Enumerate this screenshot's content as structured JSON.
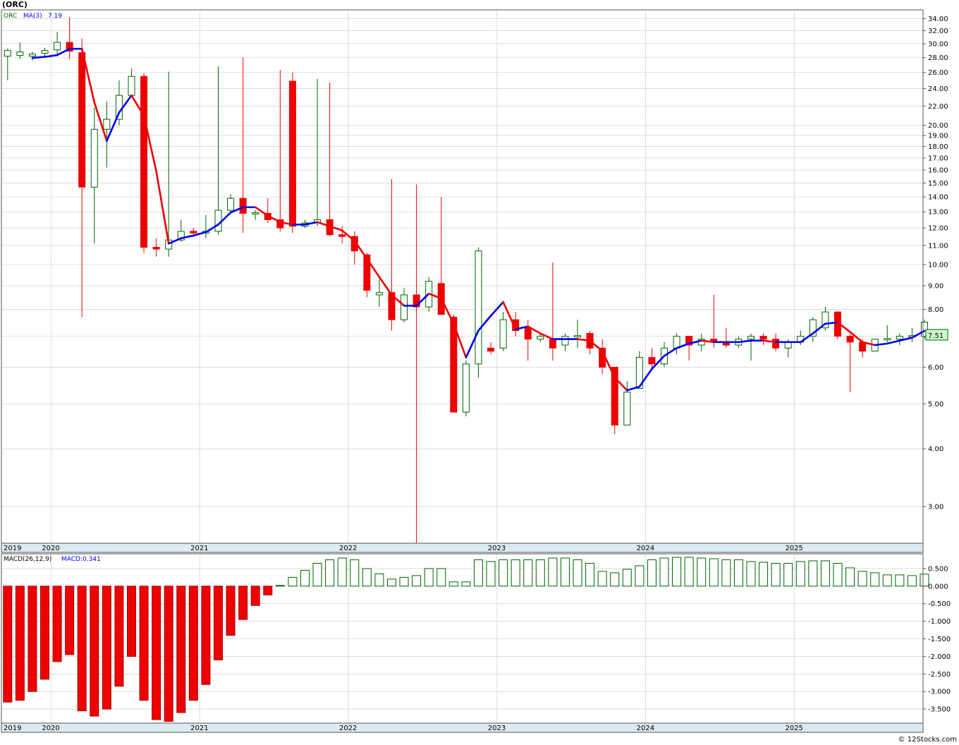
{
  "symbol": "(ORC)",
  "price_legend": {
    "ticker": "ORC",
    "ma_label": "MA(3)",
    "ma_value": "7.19"
  },
  "macd_legend": {
    "label": "MACD(26,12,9)",
    "value_label": "MACD:0.341"
  },
  "last_price": "7.51",
  "watermark": "© 12Stocks.com",
  "colors": {
    "up": "#006400",
    "down": "#ee0000",
    "ma_up": "#0000ee",
    "ma_down": "#ee0000",
    "axis_band": "#dceaf2",
    "grid": "#c8c8c8",
    "last_price_bg": "#ccffcc"
  },
  "chart_data": [
    {
      "type": "candlestick",
      "interval": "monthly",
      "scale": "log",
      "ylim": [
        2.5,
        35.5
      ],
      "y_ticks": [
        "3.00",
        "4.00",
        "5.00",
        "6.00",
        "7.00",
        "8.00",
        "9.00",
        "10.00",
        "11.00",
        "12.00",
        "13.00",
        "14.00",
        "15.00",
        "16.00",
        "17.00",
        "18.00",
        "19.00",
        "20.00",
        "22.00",
        "24.00",
        "26.00",
        "28.00",
        "30.00",
        "32.00",
        "34.00"
      ],
      "x_labels": [
        "2019",
        "2020",
        "2021",
        "2022",
        "2023",
        "2024",
        "2025"
      ],
      "x_label_months": [
        0,
        4,
        16,
        28,
        40,
        52,
        64
      ],
      "grid": true,
      "ohlc": [
        [
          28.2,
          29.3,
          25.0,
          29.0
        ],
        [
          28.3,
          30.2,
          27.8,
          28.8
        ],
        [
          28.2,
          28.8,
          27.6,
          28.5
        ],
        [
          28.6,
          29.4,
          28.0,
          29.0
        ],
        [
          29.1,
          31.8,
          28.5,
          30.2
        ],
        [
          30.2,
          34.2,
          27.8,
          28.9
        ],
        [
          28.7,
          30.8,
          7.7,
          14.7
        ],
        [
          14.7,
          21.8,
          11.1,
          19.6
        ],
        [
          19.6,
          22.5,
          16.2,
          20.6
        ],
        [
          20.6,
          25.0,
          20.0,
          23.2
        ],
        [
          23.2,
          26.5,
          23.0,
          25.5
        ],
        [
          25.5,
          25.9,
          10.6,
          10.9
        ],
        [
          10.9,
          11.4,
          10.4,
          10.8
        ],
        [
          10.8,
          26.1,
          10.4,
          11.3
        ],
        [
          11.3,
          12.5,
          11.2,
          11.8
        ],
        [
          11.8,
          12.0,
          11.5,
          11.7
        ],
        [
          11.7,
          12.8,
          11.4,
          11.8
        ],
        [
          11.8,
          26.8,
          11.6,
          13.1
        ],
        [
          13.1,
          14.2,
          13.0,
          13.9
        ],
        [
          13.9,
          28.0,
          11.7,
          12.9
        ],
        [
          12.9,
          13.1,
          12.5,
          12.9
        ],
        [
          12.9,
          13.9,
          12.3,
          12.5
        ],
        [
          12.5,
          26.3,
          11.8,
          12.0
        ],
        [
          24.9,
          26.0,
          11.7,
          12.1
        ],
        [
          12.1,
          12.5,
          12.0,
          12.3
        ],
        [
          12.3,
          25.2,
          12.1,
          12.5
        ],
        [
          12.5,
          24.7,
          11.5,
          11.6
        ],
        [
          11.6,
          12.1,
          11.1,
          11.5
        ],
        [
          11.5,
          11.8,
          10.0,
          10.7
        ],
        [
          10.5,
          10.6,
          8.5,
          8.8
        ],
        [
          8.6,
          9.3,
          8.1,
          8.7
        ],
        [
          8.7,
          15.3,
          7.2,
          7.6
        ],
        [
          7.6,
          8.9,
          7.5,
          8.6
        ],
        [
          8.6,
          14.9,
          2.5,
          8.1
        ],
        [
          8.1,
          9.4,
          7.9,
          9.2
        ],
        [
          9.1,
          14.0,
          7.8,
          7.8
        ],
        [
          7.7,
          7.8,
          4.8,
          4.8
        ],
        [
          4.8,
          6.2,
          4.7,
          6.1
        ],
        [
          6.1,
          10.9,
          5.7,
          10.7
        ],
        [
          6.6,
          6.8,
          6.4,
          6.5
        ],
        [
          6.6,
          7.9,
          6.5,
          7.6
        ],
        [
          7.6,
          7.9,
          7.0,
          7.2
        ],
        [
          7.3,
          7.6,
          6.2,
          6.9
        ],
        [
          6.9,
          7.1,
          6.8,
          7.0
        ],
        [
          6.9,
          10.1,
          6.2,
          6.6
        ],
        [
          6.7,
          7.1,
          6.5,
          7.0
        ],
        [
          7.0,
          7.6,
          6.6,
          7.0
        ],
        [
          7.1,
          7.2,
          6.4,
          6.6
        ],
        [
          6.6,
          6.9,
          5.8,
          6.0
        ],
        [
          6.0,
          6.0,
          4.3,
          4.5
        ],
        [
          4.5,
          5.6,
          4.5,
          5.3
        ],
        [
          5.4,
          6.5,
          5.4,
          6.3
        ],
        [
          6.3,
          6.6,
          5.9,
          6.1
        ],
        [
          6.1,
          6.8,
          6.0,
          6.6
        ],
        [
          6.6,
          7.1,
          6.4,
          7.0
        ],
        [
          7.0,
          7.0,
          6.2,
          6.7
        ],
        [
          6.7,
          7.1,
          6.5,
          6.9
        ],
        [
          6.9,
          8.6,
          6.6,
          6.8
        ],
        [
          6.8,
          7.3,
          6.6,
          6.7
        ],
        [
          6.7,
          7.0,
          6.6,
          6.9
        ],
        [
          6.9,
          7.1,
          6.2,
          7.0
        ],
        [
          7.0,
          7.1,
          6.7,
          6.9
        ],
        [
          6.9,
          7.1,
          6.5,
          6.6
        ],
        [
          6.6,
          6.9,
          6.3,
          6.8
        ],
        [
          6.8,
          7.2,
          6.7,
          7.0
        ],
        [
          7.0,
          7.7,
          6.8,
          7.6
        ],
        [
          7.3,
          8.1,
          7.2,
          7.9
        ],
        [
          7.9,
          7.9,
          6.9,
          7.0
        ],
        [
          7.0,
          7.1,
          5.3,
          6.8
        ],
        [
          6.8,
          6.9,
          6.3,
          6.5
        ],
        [
          6.5,
          6.9,
          6.5,
          6.9
        ],
        [
          6.9,
          7.4,
          6.8,
          6.9
        ],
        [
          6.9,
          7.1,
          6.7,
          7.0
        ],
        [
          7.0,
          7.3,
          6.8,
          7.0
        ],
        [
          7.0,
          7.6,
          6.9,
          7.51
        ]
      ],
      "ma3": [
        null,
        null,
        27.95,
        28.1,
        28.35,
        29.25,
        29.25,
        22.4,
        18.5,
        21.3,
        23.2,
        20.95,
        15.9,
        11.1,
        11.4,
        11.55,
        11.75,
        12.2,
        12.95,
        13.3,
        13.3,
        12.75,
        12.35,
        12.2,
        12.2,
        12.35,
        12.1,
        11.85,
        11.25,
        10.3,
        9.4,
        8.6,
        8.15,
        8.15,
        8.65,
        8.45,
        7.45,
        6.3,
        7.2,
        7.75,
        8.3,
        7.25,
        7.35,
        7.1,
        6.9,
        6.9,
        6.9,
        6.85,
        6.5,
        5.7,
        5.35,
        5.45,
        5.95,
        6.35,
        6.6,
        6.75,
        6.85,
        6.8,
        6.8,
        6.8,
        6.85,
        6.85,
        6.8,
        6.8,
        6.8,
        7.1,
        7.45,
        7.5,
        7.15,
        6.8,
        6.7,
        6.75,
        6.85,
        6.95,
        7.19
      ]
    },
    {
      "type": "bar",
      "name": "MACD(26,12,9)",
      "ylim": [
        -3.9,
        0.92
      ],
      "y_ticks": [
        "0.500",
        "0.000",
        "-0.500",
        "-1.000",
        "-1.500",
        "-2.000",
        "-2.500",
        "-3.000",
        "-3.500"
      ],
      "values": [
        -3.3,
        -3.25,
        -3.0,
        -2.65,
        -2.15,
        -1.95,
        -3.55,
        -3.7,
        -3.5,
        -2.85,
        -2.0,
        -3.25,
        -3.8,
        -3.85,
        -3.6,
        -3.25,
        -2.8,
        -2.1,
        -1.4,
        -0.95,
        -0.55,
        -0.25,
        0.02,
        0.25,
        0.45,
        0.65,
        0.75,
        0.8,
        0.75,
        0.5,
        0.35,
        0.2,
        0.25,
        0.3,
        0.5,
        0.5,
        0.12,
        0.12,
        0.75,
        0.7,
        0.75,
        0.75,
        0.75,
        0.75,
        0.8,
        0.8,
        0.75,
        0.65,
        0.42,
        0.38,
        0.48,
        0.58,
        0.75,
        0.8,
        0.82,
        0.82,
        0.8,
        0.78,
        0.75,
        0.75,
        0.7,
        0.68,
        0.65,
        0.65,
        0.7,
        0.72,
        0.72,
        0.65,
        0.52,
        0.42,
        0.38,
        0.32,
        0.32,
        0.3,
        0.341
      ]
    }
  ]
}
